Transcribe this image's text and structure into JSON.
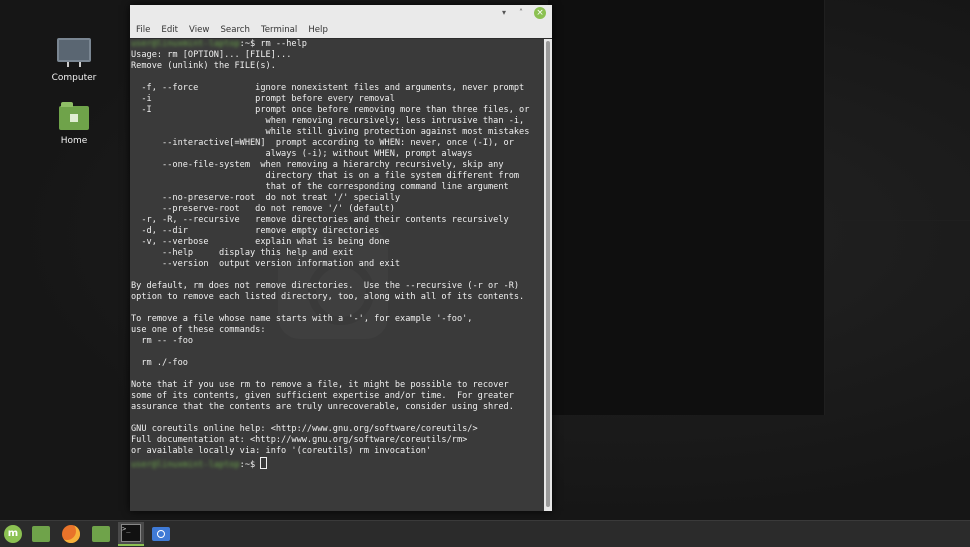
{
  "desktop": {
    "icons": [
      {
        "label": "Computer",
        "icon": "computer-icon"
      },
      {
        "label": "Home",
        "icon": "home-folder-icon"
      }
    ]
  },
  "window": {
    "title": "",
    "controls": {
      "minimize": "▾",
      "maximize": "˄",
      "close": "×"
    },
    "menu": [
      "File",
      "Edit",
      "View",
      "Search",
      "Terminal",
      "Help"
    ]
  },
  "terminal": {
    "prompt_user": "user@linuxmint-laptop",
    "prompt_suffix": ":~$",
    "command": " rm --help",
    "output": "Usage: rm [OPTION]... [FILE]...\nRemove (unlink) the FILE(s).\n\n  -f, --force           ignore nonexistent files and arguments, never prompt\n  -i                    prompt before every removal\n  -I                    prompt once before removing more than three files, or\n                          when removing recursively; less intrusive than -i,\n                          while still giving protection against most mistakes\n      --interactive[=WHEN]  prompt according to WHEN: never, once (-I), or\n                          always (-i); without WHEN, prompt always\n      --one-file-system  when removing a hierarchy recursively, skip any\n                          directory that is on a file system different from\n                          that of the corresponding command line argument\n      --no-preserve-root  do not treat '/' specially\n      --preserve-root   do not remove '/' (default)\n  -r, -R, --recursive   remove directories and their contents recursively\n  -d, --dir             remove empty directories\n  -v, --verbose         explain what is being done\n      --help     display this help and exit\n      --version  output version information and exit\n\nBy default, rm does not remove directories.  Use the --recursive (-r or -R)\noption to remove each listed directory, too, along with all of its contents.\n\nTo remove a file whose name starts with a '-', for example '-foo',\nuse one of these commands:\n  rm -- -foo\n\n  rm ./-foo\n\nNote that if you use rm to remove a file, it might be possible to recover\nsome of its contents, given sufficient expertise and/or time.  For greater\nassurance that the contents are truly unrecoverable, consider using shred.\n\nGNU coreutils online help: <http://www.gnu.org/software/coreutils/>\nFull documentation at: <http://www.gnu.org/software/coreutils/rm>\nor available locally via: info '(coreutils) rm invocation'",
    "final_prompt_suffix": ":~$ "
  },
  "taskbar": {
    "items": [
      {
        "name": "menu-button",
        "glyph": "m"
      },
      {
        "name": "show-desktop",
        "glyph": ""
      },
      {
        "name": "firefox",
        "glyph": ""
      },
      {
        "name": "files",
        "glyph": ""
      },
      {
        "name": "terminal",
        "glyph": ">_"
      },
      {
        "name": "screenshot",
        "glyph": ""
      }
    ],
    "accent": "#8cc152"
  }
}
